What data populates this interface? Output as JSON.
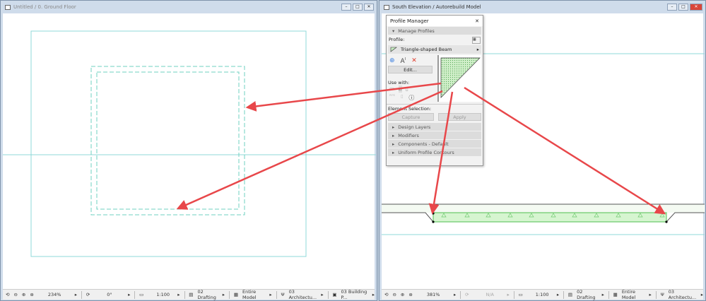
{
  "left_window": {
    "title": "Untitled / 0. Ground Floor",
    "status": {
      "zoom": "234%",
      "angle": "0°",
      "scale": "1:100",
      "layer_combo": "02 Drafting",
      "model_view": "Entire Model",
      "pen_set": "03 Architectu...",
      "dimension": "03 Building P..."
    }
  },
  "right_window": {
    "title": "South Elevation / Autorebuild Model",
    "status": {
      "zoom": "381%",
      "angle": "N/A",
      "scale": "1:100",
      "layer_combo": "02 Drafting",
      "model_view": "Entire Model",
      "pen_set": "03 Architectu..."
    }
  },
  "profile_manager": {
    "title": "Profile Manager",
    "manage_section": "Manage Profiles",
    "profile_label": "Profile:",
    "profile_name": "Triangle-shaped Beam",
    "edit_button": "Edit...",
    "use_with_label": "Use with:",
    "element_selection_label": "Element Selection:",
    "capture_button": "Capture",
    "apply_button": "Apply",
    "sections": [
      "Design Layers",
      "Modifiers",
      "Components - Default",
      "Uniform Profile Contours"
    ]
  },
  "colors": {
    "arrow": "#e8474a",
    "guide": "#8fd8d8",
    "beam_fill": "#d6f5d0",
    "beam_stroke": "#4fbf4f"
  }
}
